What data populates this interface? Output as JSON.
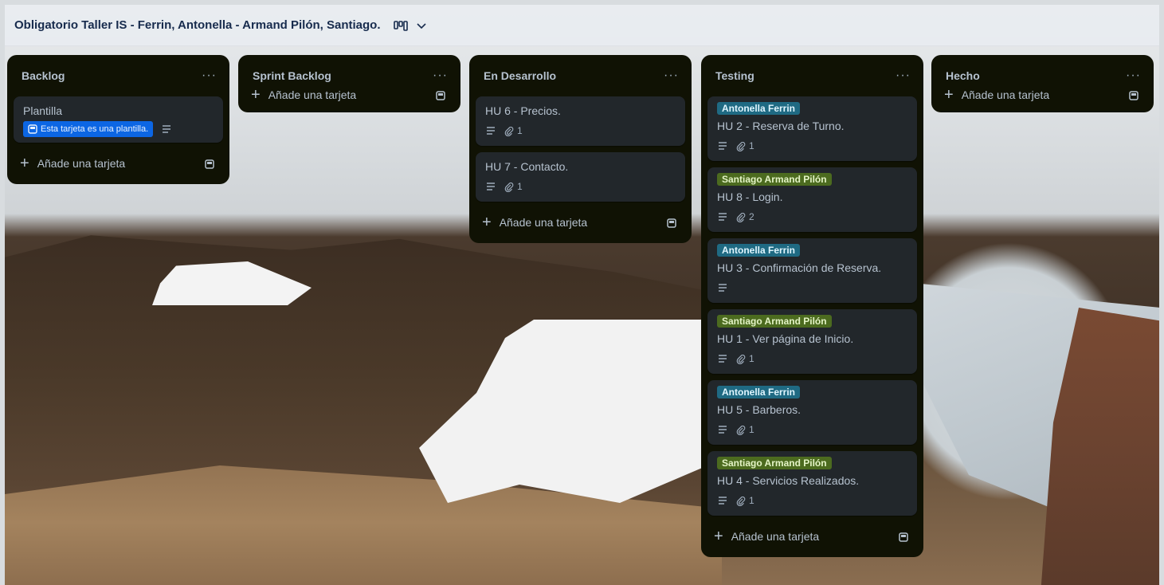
{
  "board": {
    "title": "Obligatorio Taller IS - Ferrin, Antonella - Armand Pilón, Santiago."
  },
  "add_card_label": "Añade una tarjeta",
  "lists": [
    {
      "title": "Backlog",
      "cards": [
        {
          "title": "Plantilla",
          "template_badge": "Esta tarjeta es una plantilla."
        }
      ]
    },
    {
      "title": "Sprint Backlog",
      "cards": []
    },
    {
      "title": "En Desarrollo",
      "cards": [
        {
          "title": "HU 6 - Precios.",
          "attachments": "1"
        },
        {
          "title": "HU 7 - Contacto.",
          "attachments": "1"
        }
      ]
    },
    {
      "title": "Testing",
      "cards": [
        {
          "label": "Antonella Ferrin",
          "title": "HU 2 - Reserva de Turno.",
          "attachments": "1"
        },
        {
          "label": "Santiago Armand Pilón",
          "title": "HU 8 - Login.",
          "attachments": "2"
        },
        {
          "label": "Antonella Ferrin",
          "title": "HU 3 - Confirmación de Reserva."
        },
        {
          "label": "Santiago Armand Pilón",
          "title": "HU 1 - Ver página de Inicio.",
          "attachments": "1"
        },
        {
          "label": "Antonella Ferrin",
          "title": "HU 5 - Barberos.",
          "attachments": "1"
        },
        {
          "label": "Santiago Armand Pilón",
          "title": "HU 4 - Servicios Realizados.",
          "attachments": "1"
        }
      ]
    },
    {
      "title": "Hecho",
      "cards": []
    }
  ],
  "colors": {
    "list_bg": "#101204",
    "card_bg": "#22272b",
    "label_antonella": "#1f6a83",
    "label_santiago": "#4c6b1f",
    "template_badge": "#0c66e4"
  },
  "icons": {
    "view_switch": "board-view-icon",
    "view_dropdown": "chevron-down-icon",
    "list_menu": "more-icon",
    "description": "description-icon",
    "attachment": "paperclip-icon",
    "template": "template-icon",
    "add": "plus-icon"
  }
}
